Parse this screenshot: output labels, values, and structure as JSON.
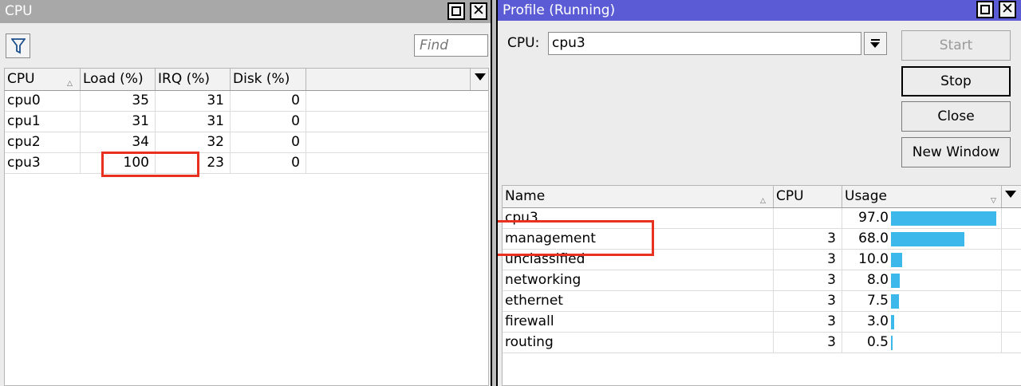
{
  "cpu_window": {
    "title": "CPU",
    "filter_icon": "filter-icon",
    "find_placeholder": "Find",
    "columns": [
      "CPU",
      "Load (%)",
      "IRQ (%)",
      "Disk (%)"
    ],
    "rows": [
      {
        "cpu": "cpu0",
        "load": "35",
        "irq": "31",
        "disk": "0"
      },
      {
        "cpu": "cpu1",
        "load": "31",
        "irq": "31",
        "disk": "0"
      },
      {
        "cpu": "cpu2",
        "load": "34",
        "irq": "32",
        "disk": "0"
      },
      {
        "cpu": "cpu3",
        "load": "100",
        "irq": "23",
        "disk": "0"
      }
    ]
  },
  "profile_window": {
    "title": "Profile (Running)",
    "cpu_label": "CPU:",
    "cpu_value": "cpu3",
    "buttons": {
      "start": "Start",
      "stop": "Stop",
      "close": "Close",
      "new_window": "New Window"
    },
    "columns": [
      "Name",
      "CPU",
      "Usage"
    ],
    "rows": [
      {
        "name": "cpu3",
        "cpu": "",
        "usage": "97.0",
        "usage_value": 97.0
      },
      {
        "name": "management",
        "cpu": "3",
        "usage": "68.0",
        "usage_value": 68.0
      },
      {
        "name": "unclassified",
        "cpu": "3",
        "usage": "10.0",
        "usage_value": 10.0
      },
      {
        "name": "networking",
        "cpu": "3",
        "usage": "8.0",
        "usage_value": 8.0
      },
      {
        "name": "ethernet",
        "cpu": "3",
        "usage": "7.5",
        "usage_value": 7.5
      },
      {
        "name": "firewall",
        "cpu": "3",
        "usage": "3.0",
        "usage_value": 3.0
      },
      {
        "name": "routing",
        "cpu": "3",
        "usage": "0.5",
        "usage_value": 0.5
      }
    ],
    "usage_bar_color": "#3cb8ea"
  },
  "highlight_color": "#e8321f"
}
